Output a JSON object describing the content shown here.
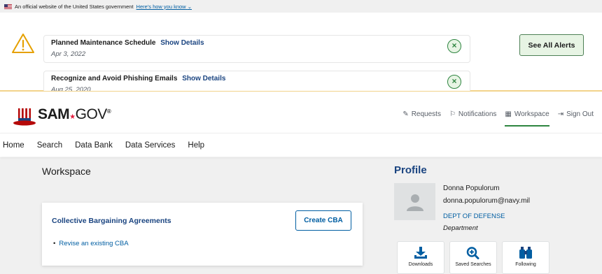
{
  "gov_banner": {
    "text": "An official website of the United States government",
    "link": "Here's how you know",
    "chevron": "⌄"
  },
  "alerts": {
    "items": [
      {
        "title": "Planned Maintenance Schedule",
        "show_label": "Show Details",
        "date": "Apr 3, 2022",
        "close": "×"
      },
      {
        "title": "Recognize and Avoid Phishing Emails",
        "show_label": "Show Details",
        "date": "Aug 25, 2020",
        "close": "×"
      }
    ],
    "see_all_label": "See All Alerts",
    "icon": "warning-icon"
  },
  "header": {
    "logo_sam": "SAM",
    "logo_star": "★",
    "logo_gov": "GOV",
    "logo_reg": "®",
    "utility_nav": [
      {
        "label": "Requests",
        "icon": "✎"
      },
      {
        "label": "Notifications",
        "icon": "⚐"
      },
      {
        "label": "Workspace",
        "icon": "▦"
      },
      {
        "label": "Sign Out",
        "icon": "⇥"
      }
    ]
  },
  "main_nav": [
    "Home",
    "Search",
    "Data Bank",
    "Data Services",
    "Help"
  ],
  "workspace": {
    "title": "Workspace",
    "cba": {
      "title": "Collective Bargaining Agreements",
      "button": "Create CBA",
      "link": "Revise an existing CBA"
    }
  },
  "profile": {
    "title": "Profile",
    "name": "Donna Populorum",
    "email": "donna.populorum@navy.mil",
    "dept": "DEPT OF DEFENSE",
    "dept_label": "Department",
    "tiles": [
      {
        "label": "Downloads",
        "icon": "download-icon"
      },
      {
        "label": "Saved Searches",
        "icon": "search-plus-icon"
      },
      {
        "label": "Following",
        "icon": "binoculars-icon"
      }
    ]
  },
  "colors": {
    "primary": "#005ea2",
    "primary_dark": "#1a4480",
    "success": "#2e8540",
    "warning_border": "#f2d38a",
    "bg_gray": "#f0f0f0"
  }
}
